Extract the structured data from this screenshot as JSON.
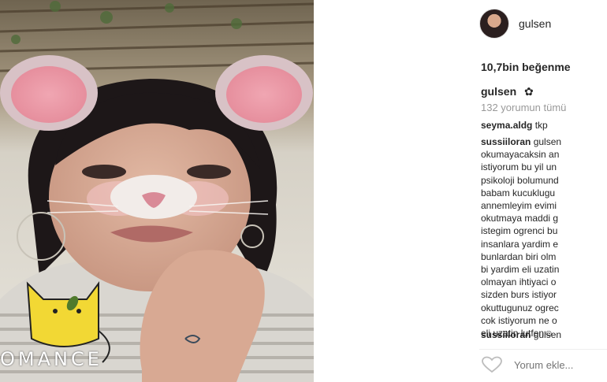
{
  "post": {
    "username": "gulsen",
    "likes": "10,7bin beğenme",
    "caption_username": "gulsen",
    "caption_icon": "flower-icon",
    "view_all_comments": "132 yorumun tümü"
  },
  "comments": [
    {
      "username": "seyma.aldg",
      "text": "tkp"
    },
    {
      "username": "sussiiloran",
      "lines": [
        "gulsen",
        "okumayacaksin an",
        "istiyorum bu yil un",
        "psikoloji bolumund",
        "babam kucuklugu",
        "annemleyim evimi",
        "okutmaya maddi g",
        "istegim ogrenci bu",
        "insanlara yardim e",
        "bunlardan biri olm",
        "bi yardim eli uzatin",
        "olmayan ihtiyaci o",
        "sizden burs istiyor",
        "okuttugunuz ogrec",
        "cok istiyorum ne o",
        "eli uzatin lutfen☺"
      ]
    },
    {
      "username": "sussiiloran",
      "text": "gulsen"
    }
  ],
  "input": {
    "placeholder": "Yorum ekle..."
  },
  "media": {
    "sticker_text": "OMANCE"
  },
  "icons": {
    "heart": "heart-outline-icon",
    "avatar": "avatar"
  }
}
